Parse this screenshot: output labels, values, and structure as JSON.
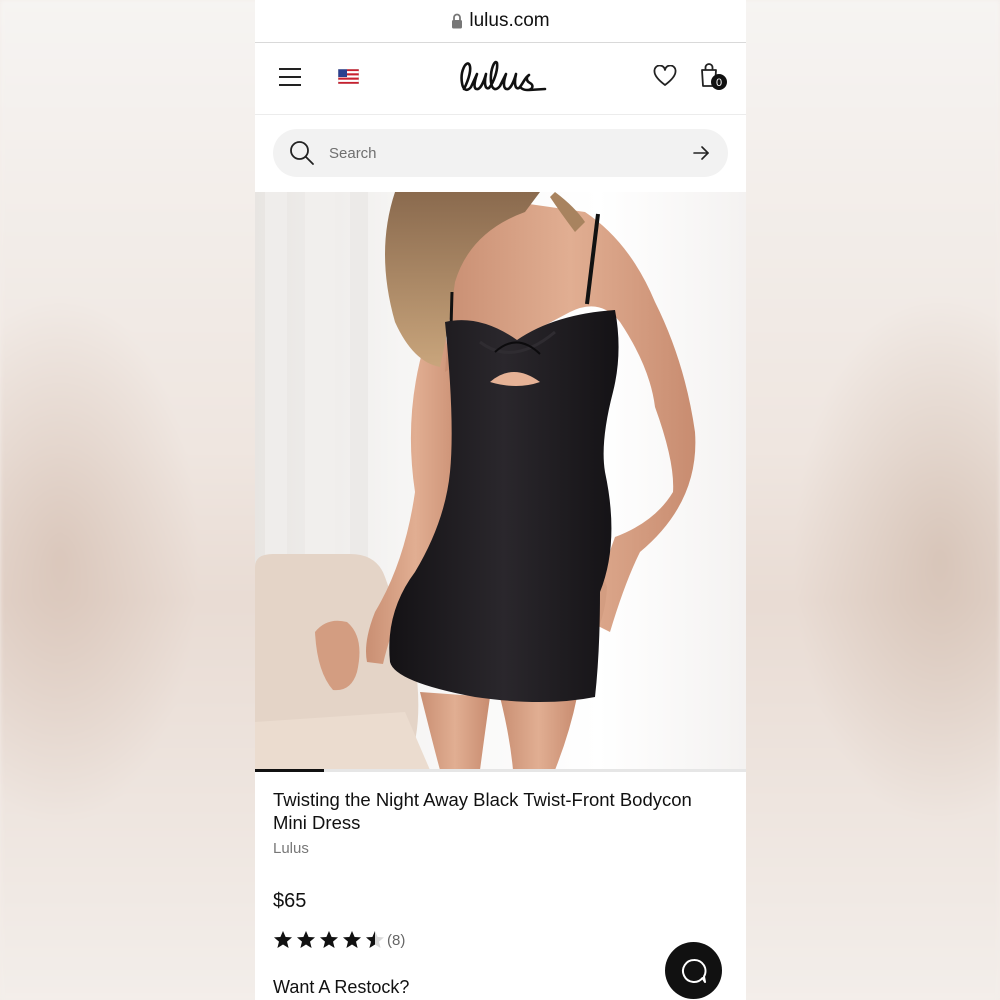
{
  "browser": {
    "url": "lulus.com"
  },
  "header": {
    "logo_text": "Lulus",
    "cart_count": "0",
    "country": "US"
  },
  "search": {
    "placeholder": "Search"
  },
  "product": {
    "title": "Twisting the Night Away Black Twist-Front Bodycon Mini Dress",
    "brand": "Lulus",
    "price": "$65",
    "rating": 4.5,
    "review_count": "(8)",
    "restock_label": "Want A Restock?",
    "image_index": 1,
    "image_total": 6,
    "carousel_progress": 0.14
  },
  "icons": [
    "lock-icon",
    "menu-icon",
    "us-flag-icon",
    "heart-icon",
    "shopping-bag-icon",
    "search-icon",
    "arrow-right-icon",
    "chat-icon"
  ],
  "colors": {
    "text": "#111111",
    "muted": "#777777",
    "search_bg": "#f2f2f2",
    "dress": "#1d1b1f"
  }
}
